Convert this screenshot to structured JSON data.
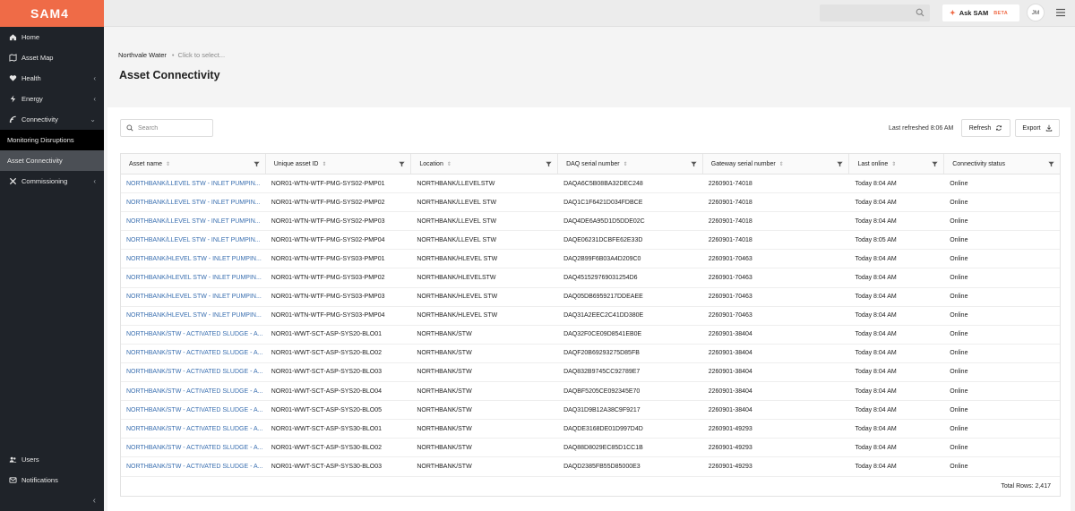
{
  "app": {
    "name": "SAM4"
  },
  "sidebar": {
    "items": [
      {
        "label": "Home",
        "icon": "home-icon"
      },
      {
        "label": "Asset Map",
        "icon": "map-icon"
      },
      {
        "label": "Health",
        "icon": "heart-icon",
        "chevron": "‹"
      },
      {
        "label": "Energy",
        "icon": "bolt-icon",
        "chevron": "‹"
      },
      {
        "label": "Connectivity",
        "icon": "signal-icon",
        "chevron": "⌄"
      },
      {
        "label": "Monitoring Disruptions"
      },
      {
        "label": "Asset Connectivity"
      },
      {
        "label": "Commissioning",
        "icon": "tools-icon",
        "chevron": "‹"
      }
    ],
    "bottom": [
      {
        "label": "Users",
        "icon": "users-icon"
      },
      {
        "label": "Notifications",
        "icon": "bell-icon"
      }
    ],
    "collapse": "‹"
  },
  "topbar": {
    "ask_label": "Ask SAM",
    "beta_label": "BETA",
    "avatar_initials": "JM"
  },
  "breadcrumb": {
    "org": "Northvale Water",
    "select": "Click to select..."
  },
  "page": {
    "title": "Asset Connectivity"
  },
  "toolbar": {
    "search_placeholder": "Search",
    "last_refreshed": "Last refreshed 8:06 AM",
    "refresh_label": "Refresh",
    "export_label": "Export"
  },
  "table": {
    "columns": [
      "Asset name",
      "Unique asset ID",
      "Location",
      "DAQ serial number",
      "Gateway serial number",
      "Last online",
      "Connectivity status"
    ],
    "rows": [
      [
        "NORTHBANK/LLEVEL STW - INLET PUMPIN...",
        "NOR01-WTN-WTF-PMG-SYS02-PMP01",
        "NORTHBANK/LLEVELSTW",
        "DAQA6C5B08BA32DEC248",
        "2260901-74018",
        "Today 8:04 AM",
        "Online"
      ],
      [
        "NORTHBANK/LLEVEL STW - INLET PUMPIN...",
        "NOR01-WTN-WTF-PMG-SYS02-PMP02",
        "NORTHBANK/LLEVEL STW",
        "DAQ1C1F6421D034FDBCE",
        "2260901-74018",
        "Today 8:04 AM",
        "Online"
      ],
      [
        "NORTHBANK/LLEVEL STW - INLET PUMPIN...",
        "NOR01-WTN-WTF-PMG-SYS02-PMP03",
        "NORTHBANK/LLEVEL STW",
        "DAQ4DE6A95D1D5DDE02C",
        "2260901-74018",
        "Today 8:04 AM",
        "Online"
      ],
      [
        "NORTHBANK/LLEVEL STW - INLET PUMPIN...",
        "NOR01-WTN-WTF-PMG-SYS02-PMP04",
        "NORTHBANK/LLEVEL STW",
        "DAQE06231DCBFE62E33D",
        "2260901-74018",
        "Today 8:05 AM",
        "Online"
      ],
      [
        "NORTHBANK/HLEVEL STW - INLET PUMPIN...",
        "NOR01-WTN-WTF-PMG-SYS03-PMP01",
        "NORTHBANK/HLEVEL STW",
        "DAQ2B99F6B03A4D209C0",
        "2260901-70463",
        "Today 8:04 AM",
        "Online"
      ],
      [
        "NORTHBANK/HLEVEL STW - INLET PUMPIN...",
        "NOR01-WTN-WTF-PMG-SYS03-PMP02",
        "NORTHBANK/HLEVELSTW",
        "DAQ451529769031254D6",
        "2260901-70463",
        "Today 8:04 AM",
        "Online"
      ],
      [
        "NORTHBANK/HLEVEL STW - INLET PUMPIN...",
        "NOR01-WTN-WTF-PMG-SYS03-PMP03",
        "NORTHBANK/HLEVEL STW",
        "DAQ05DB6959217DDEAEE",
        "2260901-70463",
        "Today 8:04 AM",
        "Online"
      ],
      [
        "NORTHBANK/HLEVEL STW - INLET PUMPIN...",
        "NOR01-WTN-WTF-PMG-SYS03-PMP04",
        "NORTHBANK/HLEVEL STW",
        "DAQ31A2EEC2C41DD380E",
        "2260901-70463",
        "Today 8:04 AM",
        "Online"
      ],
      [
        "NORTHBANK/STW - ACTIVATED SLUDGE - A...",
        "NOR01-WWT-SCT-ASP-SYS20-BLO01",
        "NORTHBANK/STW",
        "DAQ32F0CE09D8541EB0E",
        "2260901-38404",
        "Today 8:04 AM",
        "Online"
      ],
      [
        "NORTHBANK/STW - ACTIVATED SLUDGE - A...",
        "NOR01-WWT-SCT-ASP-SYS20-BLO02",
        "NORTHBANK/STW",
        "DAQF20B69293275D85FB",
        "2260901-38404",
        "Today 8:04 AM",
        "Online"
      ],
      [
        "NORTHBANK/STW - ACTIVATED SLUDGE - A...",
        "NOR01-WWT-SCT-ASP-SYS20-BLO03",
        "NORTHBANK/STW",
        "DAQ832B9745CC92789E7",
        "2260901-38404",
        "Today 8:04 AM",
        "Online"
      ],
      [
        "NORTHBANK/STW - ACTIVATED SLUDGE - A...",
        "NOR01-WWT-SCT-ASP-SYS20-BLO04",
        "NORTHBANK/STW",
        "DAQBF5205CE092345E70",
        "2260901-38404",
        "Today 8:04 AM",
        "Online"
      ],
      [
        "NORTHBANK/STW - ACTIVATED SLUDGE - A...",
        "NOR01-WWT-SCT-ASP-SYS20-BLO05",
        "NORTHBANK/STW",
        "DAQ31D9B12A38C9F9217",
        "2260901-38404",
        "Today 8:04 AM",
        "Online"
      ],
      [
        "NORTHBANK/STW - ACTIVATED SLUDGE - A...",
        "NOR01-WWT-SCT-ASP-SYS30-BLO01",
        "NORTHBANK/STW",
        "DAQDE3168DE01D997D4D",
        "2260901-49293",
        "Today 8:04 AM",
        "Online"
      ],
      [
        "NORTHBANK/STW - ACTIVATED SLUDGE - A...",
        "NOR01-WWT-SCT-ASP-SYS30-BLO02",
        "NORTHBANK/STW",
        "DAQ88D8029EC85D1CC1B",
        "2260901-49293",
        "Today 8:04 AM",
        "Online"
      ],
      [
        "NORTHBANK/STW - ACTIVATED SLUDGE - A...",
        "NOR01-WWT-SCT-ASP-SYS30-BLO03",
        "NORTHBANK/STW",
        "DAQD2385FB55D85000E3",
        "2260901-49293",
        "Today 8:04 AM",
        "Online"
      ]
    ],
    "total_rows": "Total Rows: 2,417"
  },
  "colors": {
    "brand": "#ef6b47",
    "sidebar": "#1f2329",
    "link": "#3a6fb0"
  }
}
